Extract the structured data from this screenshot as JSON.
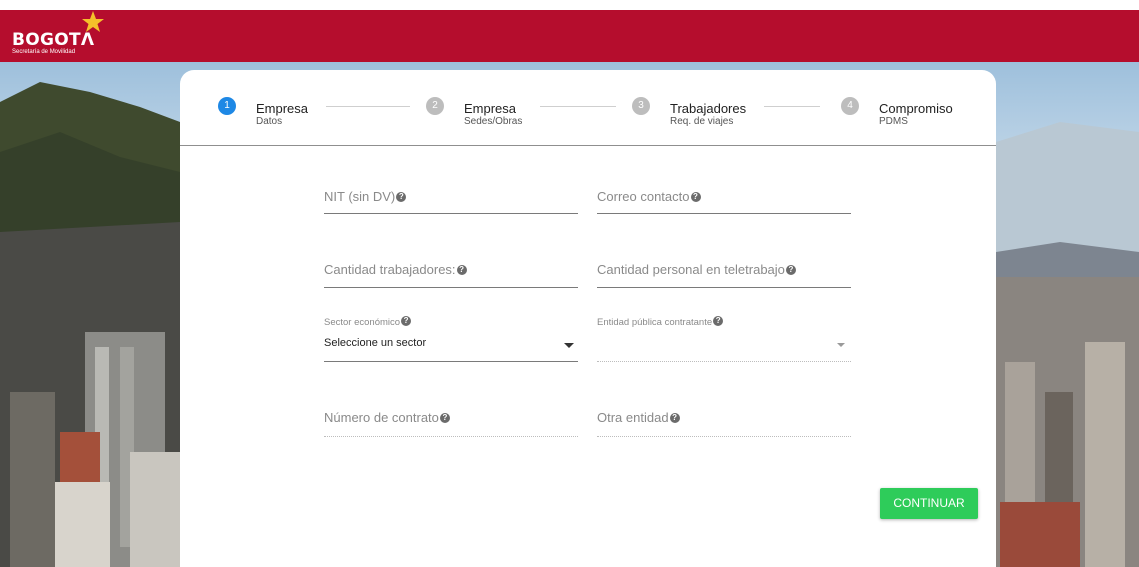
{
  "header": {
    "logo_word": "BOGOTΛ",
    "logo_subtitle": "Secretaría de Movilidad",
    "brand_color": "#b50d2d"
  },
  "stepper": [
    {
      "number": "1",
      "title": "Empresa",
      "subtitle": "Datos",
      "active": true
    },
    {
      "number": "2",
      "title": "Empresa",
      "subtitle": "Sedes/Obras",
      "active": false
    },
    {
      "number": "3",
      "title": "Trabajadores",
      "subtitle": "Req. de viajes",
      "active": false
    },
    {
      "number": "4",
      "title": "Compromiso",
      "subtitle": "PDMS",
      "active": false
    }
  ],
  "form": {
    "nit_label": "NIT (sin DV)",
    "email_label": "Correo contacto",
    "workers_label": "Cantidad trabajadores:",
    "telework_label": "Cantidad personal en teletrabajo",
    "sector_label": "Sector económico",
    "sector_value": "Seleccione un sector",
    "entity_label": "Entidad pública contratante",
    "entity_value": "",
    "contract_label": "Número de contrato",
    "other_entity_label": "Otra entidad"
  },
  "actions": {
    "continue_label": "CONTINUAR",
    "continue_color": "#2ecc5a"
  },
  "icons": {
    "help": "question-circle-icon",
    "select": "caret-down-icon"
  }
}
